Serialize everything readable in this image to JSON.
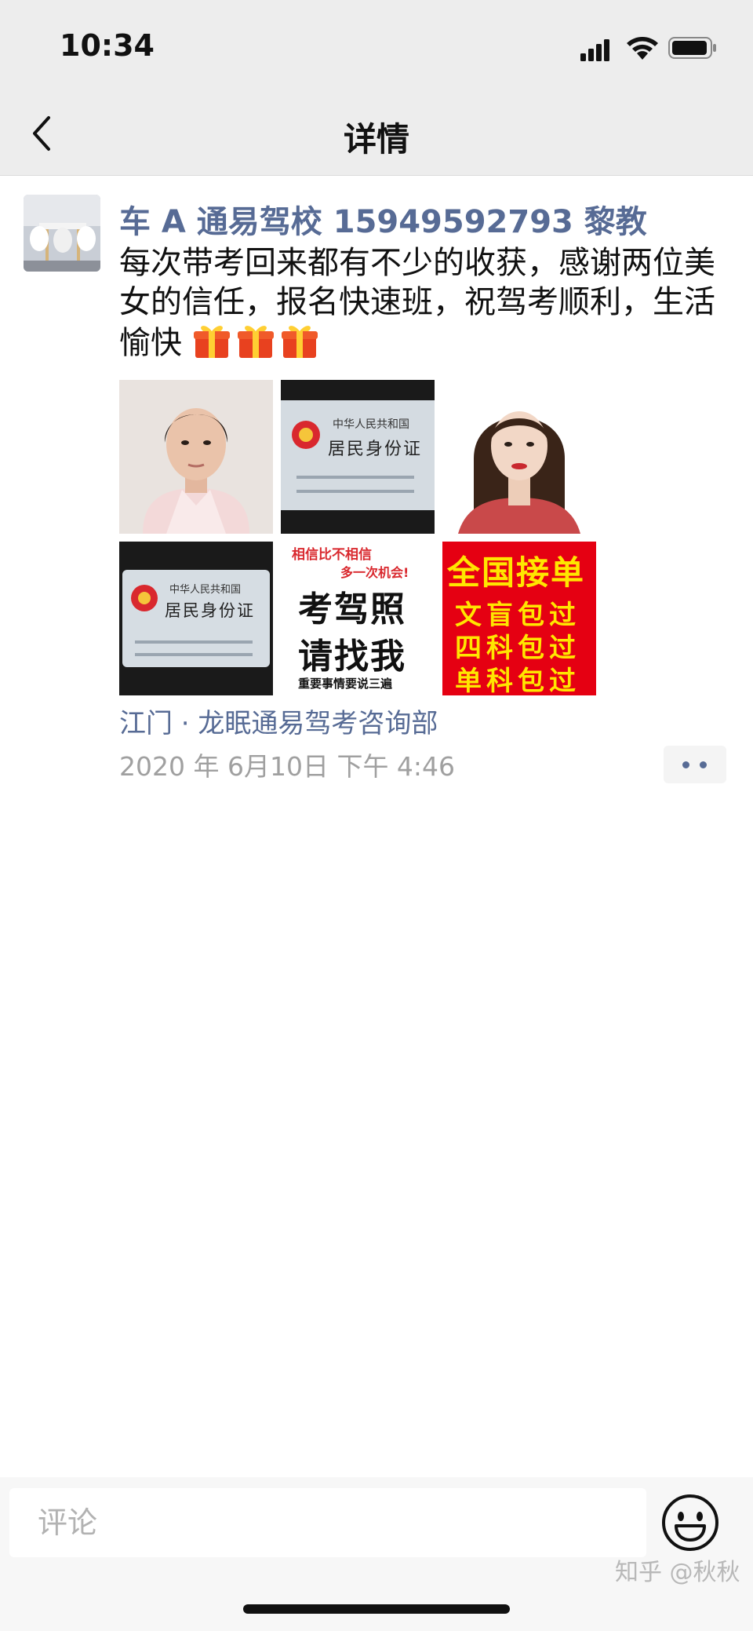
{
  "status": {
    "time": "10:34"
  },
  "nav": {
    "title": "详情"
  },
  "post": {
    "author": "车 A 通易驾校 15949592793 黎教",
    "text": "每次带考回来都有不少的收获，感谢两位美女的信任，报名快速班，祝驾考顺利，生活愉快",
    "emoji": "gift-emoji",
    "images": {
      "idcard_country": "中华人民共和国",
      "idcard_title": "居民身份证",
      "ad_top": "相信比不相信",
      "ad_chance": "多一次机会!",
      "ad_main_1": "考驾照",
      "ad_main_2": "请找我",
      "ad_footer": "重要事情要说三遍",
      "red_title": "全国接单",
      "red_line_1": "文盲包过",
      "red_line_2": "四科包过",
      "red_line_3": "单科包过"
    },
    "location": "江门 · 龙眠通易驾考咨询部",
    "timestamp": "2020 年 6月10日 下午 4:46"
  },
  "comment": {
    "placeholder": "评论"
  },
  "watermark": "知乎 @秋秋",
  "colors": {
    "link": "#576b95",
    "nav_bg": "#ededed",
    "ad_red": "#e50012",
    "ad_yellow": "#ffe600"
  }
}
